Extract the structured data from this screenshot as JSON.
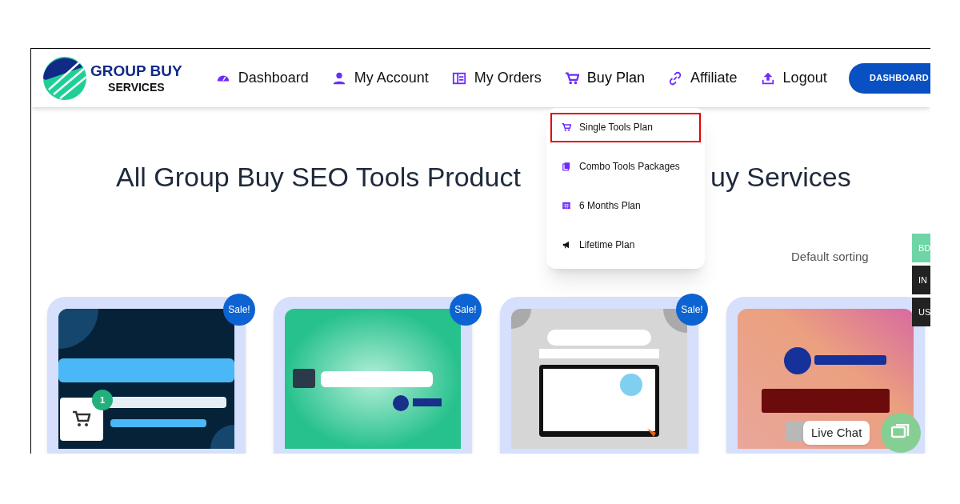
{
  "logo": {
    "line_1": "GROUP BUY",
    "line_2": "SERVICES"
  },
  "nav": [
    {
      "label": "Dashboard",
      "expanded": false
    },
    {
      "label": "My Account",
      "expanded": false
    },
    {
      "label": "My Orders",
      "expanded": false
    },
    {
      "label": "Buy Plan",
      "expanded": true
    },
    {
      "label": "Affiliate",
      "expanded": false
    },
    {
      "label": "Logout",
      "expanded": false
    }
  ],
  "dashboard_button": "DASHBOARD",
  "dropdown": [
    {
      "label": "Single Tools Plan",
      "selected": true
    },
    {
      "label": "Combo Tools Packages",
      "selected": false
    },
    {
      "label": "6 Months Plan",
      "selected": false
    },
    {
      "label": "Lifetime Plan",
      "selected": false
    }
  ],
  "heading": {
    "left": "All Group Buy SEO Tools Product",
    "right": "uy Services"
  },
  "sorting": "Default sorting",
  "currencies": [
    {
      "label": "BD",
      "selected": true
    },
    {
      "label": "IN",
      "selected": false
    },
    {
      "label": "US",
      "selected": false
    }
  ],
  "products": [
    {
      "kind": "picture",
      "sale": "Sale!"
    },
    {
      "kind": "picture",
      "sale": "Sale!"
    },
    {
      "kind": "picture",
      "sale": "Sale!"
    },
    {
      "kind": "picture"
    }
  ],
  "cart_widget": {
    "count": "1"
  },
  "live_chat": "Live Chat"
}
